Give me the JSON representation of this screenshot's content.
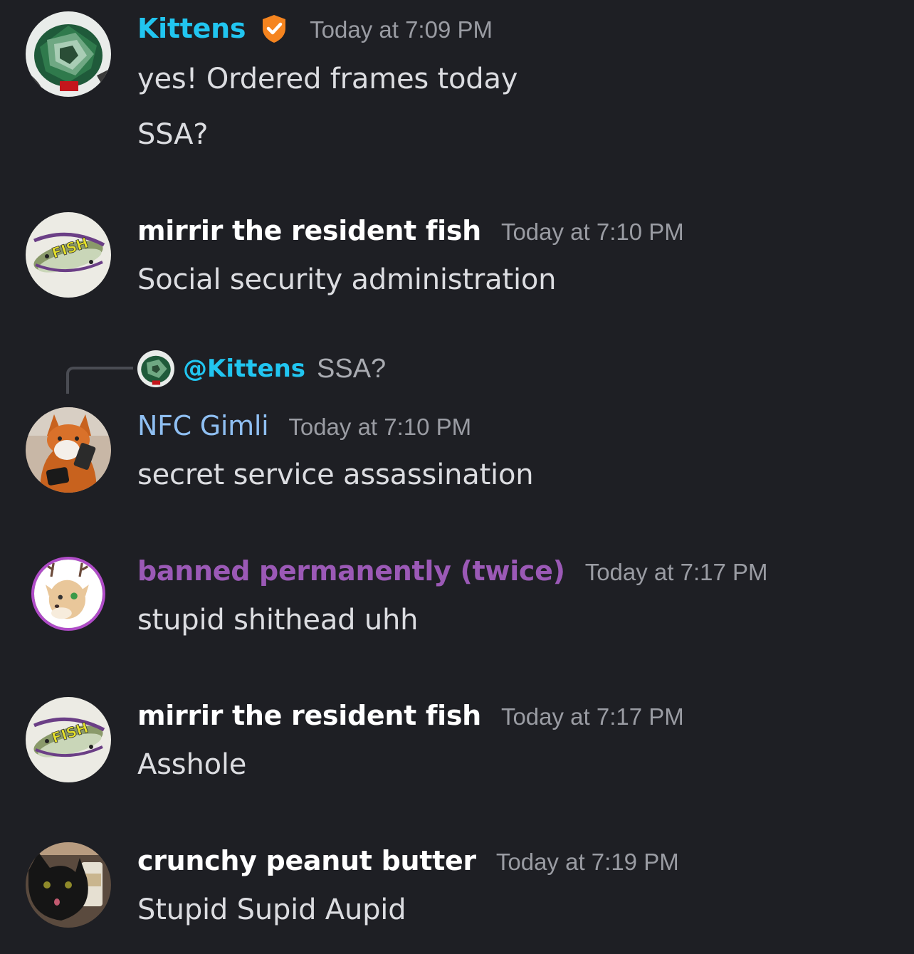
{
  "messages": [
    {
      "author": "Kittens",
      "author_color": "#21c5f0",
      "verified_icon": "verified-check-icon",
      "timestamp": "Today at 7:09 PM",
      "lines": [
        "yes! Ordered frames today",
        "SSA?"
      ]
    },
    {
      "author": "mirrir the resident fish",
      "author_color": "#ffffff",
      "timestamp": "Today at 7:10 PM",
      "lines": [
        "Social security administration"
      ]
    },
    {
      "reply": {
        "mention": "@Kittens",
        "text": "SSA?"
      },
      "author": "NFC Gimli",
      "author_color": "#8fbff2",
      "timestamp": "Today at 7:10 PM",
      "lines": [
        "secret service assassination"
      ]
    },
    {
      "author": "banned permanently (twice)",
      "author_color": "#9b59b6",
      "timestamp": "Today at 7:17 PM",
      "lines": [
        "stupid shithead uhh"
      ]
    },
    {
      "author": "mirrir the resident fish",
      "author_color": "#ffffff",
      "timestamp": "Today at 7:17 PM",
      "lines": [
        "Asshole"
      ]
    },
    {
      "author": "crunchy peanut butter",
      "author_color": "#ffffff",
      "timestamp": "Today at 7:19 PM",
      "lines": [
        "Stupid Supid Aupid"
      ]
    }
  ],
  "colors": {
    "background": "#1e1f24",
    "timestamp": "#9a9ca3",
    "message_text": "#dcdde1",
    "mention": "#21c5f0",
    "badge": "#f5841f"
  }
}
